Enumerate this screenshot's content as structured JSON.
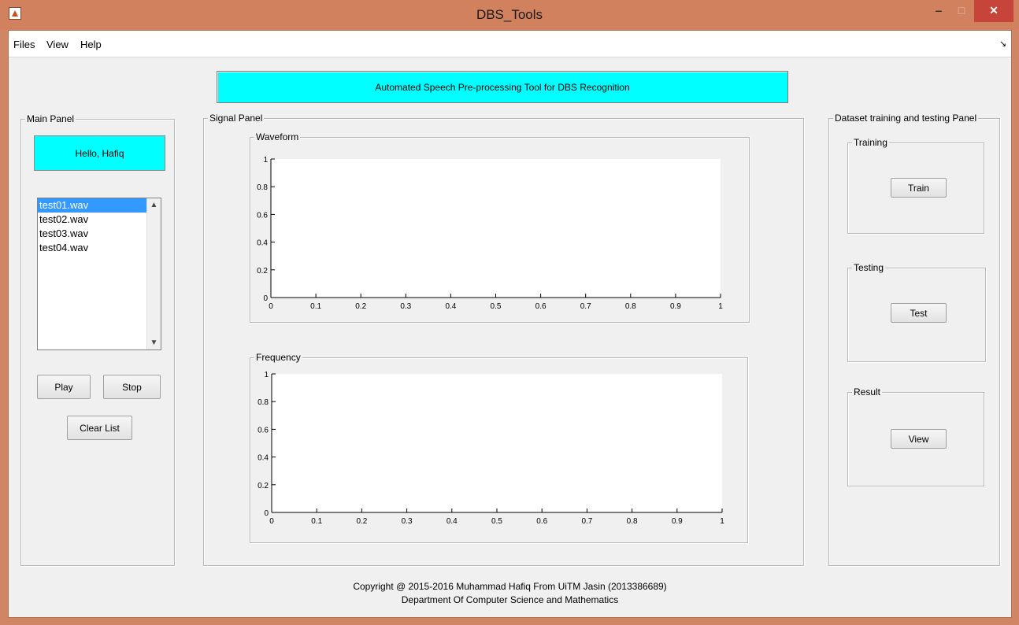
{
  "window": {
    "title": "DBS_Tools",
    "minimize": "‒",
    "maximize": "□",
    "close": "✕"
  },
  "menu": {
    "items": [
      "Files",
      "View",
      "Help"
    ],
    "arrow": "↘"
  },
  "banner": {
    "text": "Automated Speech Pre-processing Tool for DBS Recognition",
    "color": "#00ffff"
  },
  "main_panel": {
    "title": "Main Panel",
    "greeting": "Hello, Hafiq",
    "files": [
      "test01.wav",
      "test02.wav",
      "test03.wav",
      "test04.wav"
    ],
    "selected_index": 0,
    "play_label": "Play",
    "stop_label": "Stop",
    "clear_label": "Clear List"
  },
  "signal_panel": {
    "title": "Signal Panel",
    "waveform": {
      "title": "Waveform"
    },
    "frequency": {
      "title": "Frequency"
    },
    "x_ticks": [
      "0",
      "0.1",
      "0.2",
      "0.3",
      "0.4",
      "0.5",
      "0.6",
      "0.7",
      "0.8",
      "0.9",
      "1"
    ],
    "y_ticks": [
      "0",
      "0.2",
      "0.4",
      "0.6",
      "0.8",
      "1"
    ]
  },
  "dataset_panel": {
    "title": "Dataset training and testing Panel",
    "training": {
      "title": "Training",
      "button": "Train"
    },
    "testing": {
      "title": "Testing",
      "button": "Test"
    },
    "result": {
      "title": "Result",
      "button": "View"
    }
  },
  "footer": {
    "line1": "Copyright @ 2015-2016 Muhammad Hafiq From UiTM Jasin (2013386689)",
    "line2": "Department Of Computer Science and Mathematics"
  }
}
